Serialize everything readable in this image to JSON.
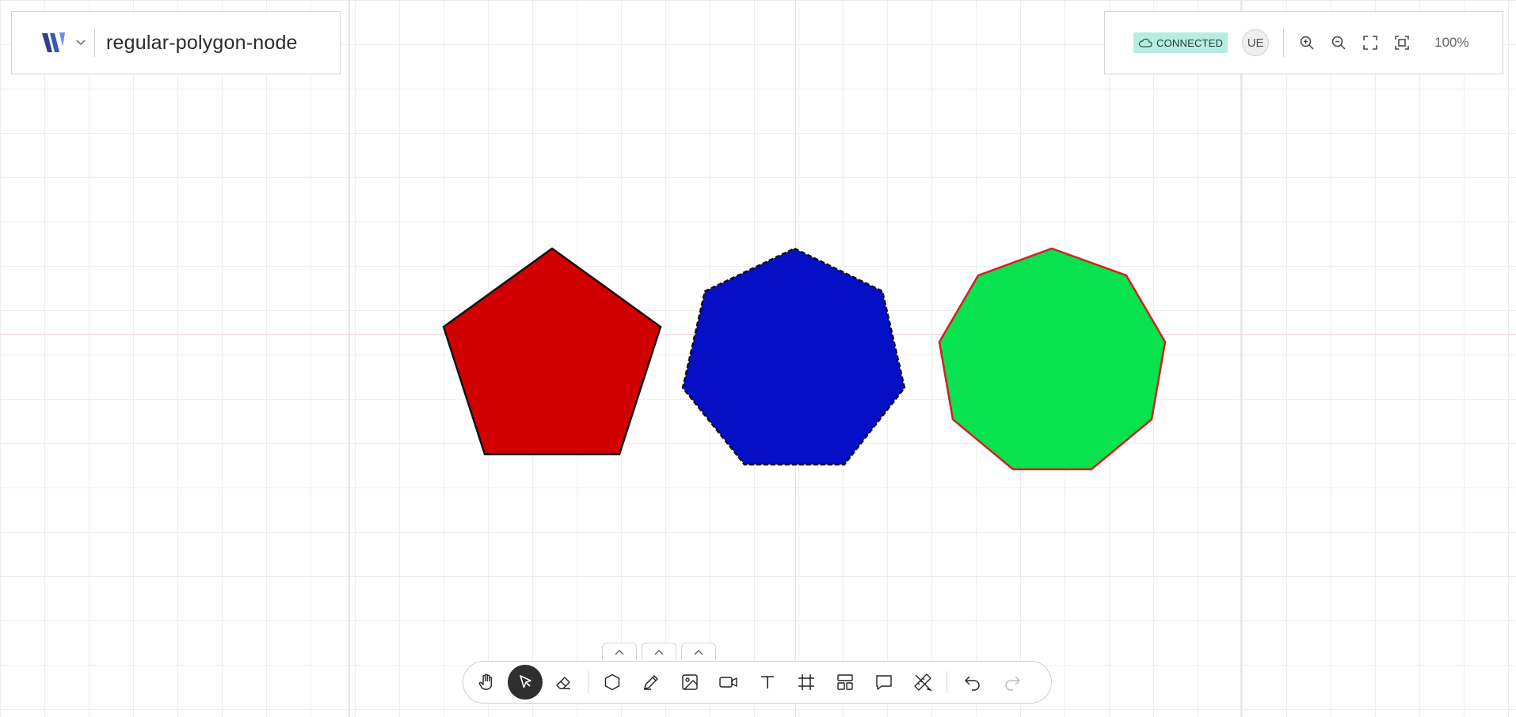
{
  "header": {
    "document_title": "regular-polygon-node",
    "logo_icon": "brand-logo-icon",
    "menu_icon": "chevron-down-icon"
  },
  "status": {
    "connection_label": "CONNECTED",
    "connection_icon": "cloud-icon",
    "connection_color": "#b7ece1",
    "user_initials": "UE",
    "zoom_level": "100%"
  },
  "zoom_controls": [
    "zoom-in-icon",
    "zoom-out-icon",
    "fullscreen-icon",
    "fit-to-screen-icon"
  ],
  "canvas": {
    "shapes": [
      {
        "type": "pentagon",
        "sides": 5,
        "fill": "#d10000",
        "stroke": "#111111",
        "stroke_style": "solid"
      },
      {
        "type": "heptagon",
        "sides": 7,
        "fill": "#0510c6",
        "stroke": "#111111",
        "stroke_style": "dashed"
      },
      {
        "type": "nonagon",
        "sides": 9,
        "fill": "#08e24f",
        "stroke": "#d32020",
        "stroke_style": "solid"
      }
    ]
  },
  "toolbar": {
    "tools": [
      "hand-icon",
      "pointer-icon",
      "eraser-icon",
      "hexagon-icon",
      "pencil-icon",
      "image-icon",
      "video-icon",
      "text-icon",
      "frame-icon",
      "template-icon",
      "comment-icon",
      "ruler-pencil-icon",
      "undo-icon",
      "redo-icon"
    ],
    "active_tool": "pointer-icon",
    "expand_tabs": [
      "chevron-up-icon",
      "chevron-up-icon",
      "chevron-up-icon"
    ]
  }
}
